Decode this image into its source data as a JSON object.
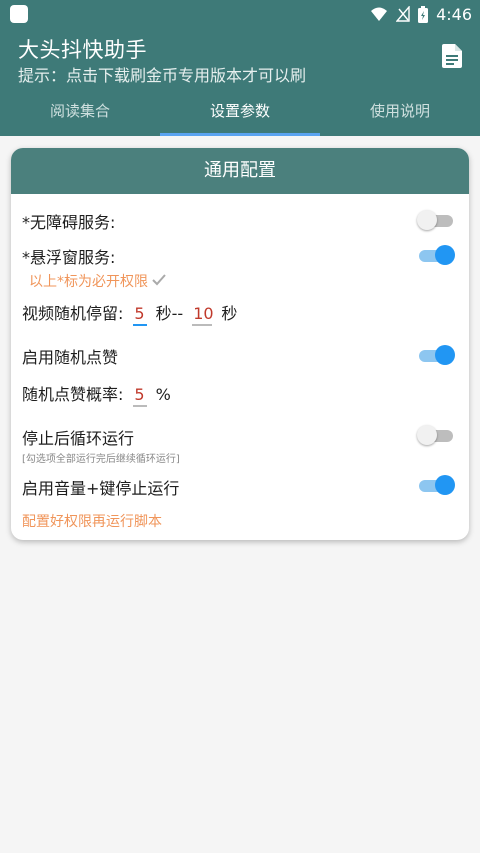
{
  "status_bar": {
    "time": "4:46"
  },
  "app_bar": {
    "title": "大头抖快助手",
    "subtitle": "提示：点击下载刷金币专用版本才可以刷",
    "doc_icon": "document-icon"
  },
  "tabs": [
    {
      "label": "阅读集合",
      "active": false
    },
    {
      "label": "设置参数",
      "active": true
    },
    {
      "label": "使用说明",
      "active": false
    }
  ],
  "card": {
    "title": "通用配置",
    "accessibility": {
      "label": "*无障碍服务:",
      "enabled": false
    },
    "floating_window": {
      "label": "*悬浮窗服务:",
      "enabled": true
    },
    "required_note": "以上*标为必开权限",
    "video_stay": {
      "label": "视频随机停留:",
      "min": "5",
      "sep": "秒--",
      "max": "10",
      "unit": "秒"
    },
    "random_like": {
      "label": "启用随机点赞",
      "enabled": true
    },
    "like_rate": {
      "label": "随机点赞概率:",
      "value": "5",
      "unit": "%"
    },
    "loop_run": {
      "label": "停止后循环运行",
      "enabled": false,
      "hint": "[勾选项全部运行完后继续循环运行]"
    },
    "volume_stop": {
      "label": "启用音量+键停止运行",
      "enabled": true
    },
    "footer_note": "配置好权限再运行脚本"
  },
  "colors": {
    "primary": "#3e7a78",
    "card_header": "#4b807d",
    "accent": "#2196f3",
    "note": "#f0955a"
  }
}
